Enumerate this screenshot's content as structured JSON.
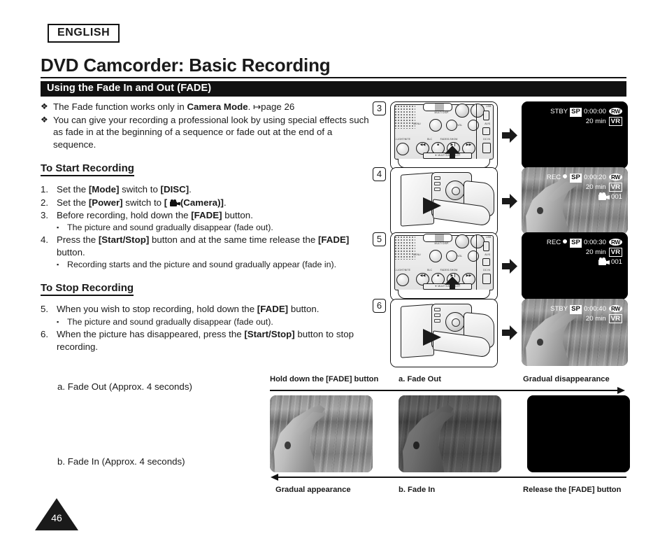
{
  "header": {
    "language_badge": "ENGLISH",
    "title": "DVD Camcorder: Basic Recording",
    "section_bar": "Using the Fade In and Out (FADE)"
  },
  "intro_bullets": [
    {
      "marker": "❖",
      "pre": "The Fade function works only in ",
      "bold": "Camera Mode",
      "post": ". ↦page 26"
    },
    {
      "marker": "❖",
      "text": "You can give your recording a professional look by using special effects such as fade in at the beginning of a sequence or fade out at the end of a sequence."
    }
  ],
  "start_section": {
    "heading": "To Start Recording",
    "steps": [
      {
        "num": "1.",
        "parts": [
          {
            "t": "Set the "
          },
          {
            "t": "[Mode]",
            "b": true
          },
          {
            "t": " switch to "
          },
          {
            "t": "[DISC]",
            "b": true
          },
          {
            "t": "."
          }
        ]
      },
      {
        "num": "2.",
        "parts": [
          {
            "t": "Set the "
          },
          {
            "t": "[Power]",
            "b": true
          },
          {
            "t": " switch to "
          },
          {
            "t": "[ ",
            "b": true
          },
          {
            "icon": "camcorder-icon"
          },
          {
            "t": "(Camera)]",
            "b": true
          },
          {
            "t": "."
          }
        ]
      },
      {
        "num": "3.",
        "parts": [
          {
            "t": "Before recording, hold down the "
          },
          {
            "t": "[FADE]",
            "b": true
          },
          {
            "t": " button."
          }
        ],
        "sub": "The picture and sound gradually disappear (fade out)."
      },
      {
        "num": "4.",
        "parts": [
          {
            "t": "Press the "
          },
          {
            "t": "[Start/Stop]",
            "b": true
          },
          {
            "t": " button and at the same time release the "
          },
          {
            "t": "[FADE]",
            "b": true
          },
          {
            "t": " button."
          }
        ],
        "sub": "Recording starts and the picture and sound gradually appear (fade in)."
      }
    ]
  },
  "stop_section": {
    "heading": "To Stop Recording",
    "steps": [
      {
        "num": "5.",
        "parts": [
          {
            "t": "When you wish to stop recording, hold down the "
          },
          {
            "t": "[FADE]",
            "b": true
          },
          {
            "t": " button."
          }
        ],
        "sub": "The picture and sound gradually disappear (fade out)."
      },
      {
        "num": "6.",
        "parts": [
          {
            "t": "When the picture has disappeared, press the "
          },
          {
            "t": "[Start/Stop]",
            "b": true
          },
          {
            "t": " button to stop recording."
          }
        ]
      }
    ]
  },
  "fade_captions": {
    "fade_out": "a. Fade Out (Approx. 4 seconds)",
    "fade_in": "b. Fade In (Approx. 4 seconds)"
  },
  "step_panels": [
    {
      "badge": "3",
      "illustration": "camcorder-side-panel",
      "arrow": "arrow-right-icon",
      "lcd": {
        "status": "STBY",
        "rec_dot": false,
        "quality": "SP",
        "timecode": "0:00:00",
        "disc_type": "RW",
        "remaining": "20 min",
        "format": "VR",
        "clip_counter": "",
        "scene": "black"
      }
    },
    {
      "badge": "4",
      "illustration": "camcorder-rear-view",
      "arrow": "arrow-right-icon",
      "lcd": {
        "status": "REC",
        "rec_dot": true,
        "quality": "SP",
        "timecode": "0:00:20",
        "disc_type": "RW",
        "remaining": "20 min",
        "format": "VR",
        "clip_counter": "001",
        "scene": "dolphin"
      }
    },
    {
      "badge": "5",
      "illustration": "camcorder-side-panel",
      "arrow": "arrow-right-icon",
      "lcd": {
        "status": "REC",
        "rec_dot": true,
        "quality": "SP",
        "timecode": "0:00:30",
        "disc_type": "RW",
        "remaining": "20 min",
        "format": "VR",
        "clip_counter": "001",
        "scene": "black"
      }
    },
    {
      "badge": "6",
      "illustration": "camcorder-rear-view",
      "arrow": "arrow-right-icon",
      "lcd": {
        "status": "STBY",
        "rec_dot": false,
        "quality": "SP",
        "timecode": "0:00:40",
        "disc_type": "RW",
        "remaining": "20 min",
        "format": "VR",
        "clip_counter": "",
        "scene": "dolphin"
      }
    }
  ],
  "side_panel_labels": {
    "multi_disp": "MULTI DISP.",
    "menu": "MENU",
    "vol": "VOL",
    "blc": "BLC",
    "fade": "FADE/S.SHOW",
    "light": "C.LIGHT/NITE",
    "usb": "USB",
    "av": "AV/S",
    "dc_in": "DC IN",
    "slot": "▼ MULTI CARD SLOT"
  },
  "filmstrip": {
    "top_labels": [
      "Hold down the [FADE] button",
      "a. Fade Out",
      "Gradual disappearance"
    ],
    "bottom_labels": [
      "Gradual appearance",
      "b. Fade In",
      "Release the [FADE] button"
    ],
    "frames": [
      {
        "name": "dolphin-bright",
        "dim": 0
      },
      {
        "name": "dolphin-dim",
        "dim": 1
      },
      {
        "name": "black-frame",
        "dim": 2
      }
    ]
  },
  "page_number": "46",
  "colors": {
    "ink": "#1a1a1a",
    "bar": "#111111",
    "paper": "#ffffff"
  }
}
